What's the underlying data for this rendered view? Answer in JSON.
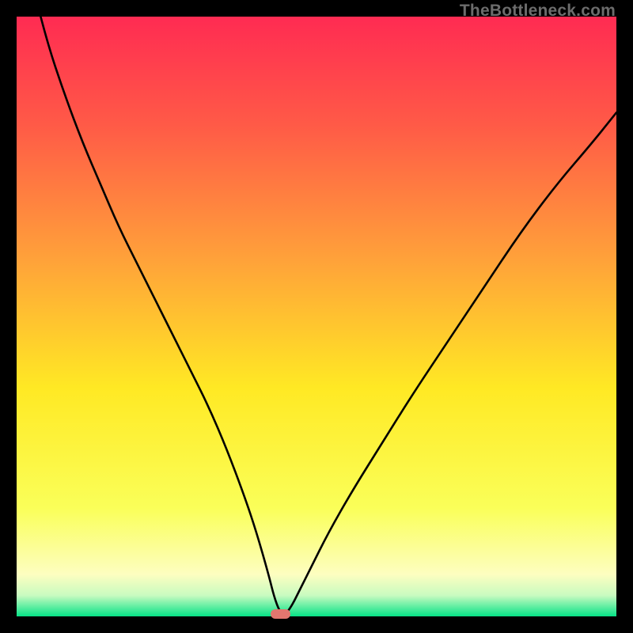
{
  "watermark": "TheBottleneck.com",
  "chart_data": {
    "type": "line",
    "title": "",
    "xlabel": "",
    "ylabel": "",
    "xlim": [
      0,
      100
    ],
    "ylim": [
      0,
      100
    ],
    "grid": false,
    "legend": false,
    "background_gradient": {
      "top": "#ff2b52",
      "mid_top": "#ffa03a",
      "mid": "#ffe924",
      "mid_bottom": "#fdfec0",
      "bottom": "#06e386"
    },
    "curve": {
      "description": "V-shaped bottleneck curve: steep descent from top-left to a near-zero minimum around x≈44, then rising toward top-right",
      "x": [
        0,
        2,
        5,
        8,
        11,
        14,
        17,
        20,
        23,
        26,
        29,
        32,
        35,
        38,
        40,
        42,
        43,
        44,
        45,
        46,
        47,
        49,
        52,
        56,
        61,
        66,
        72,
        78,
        84,
        90,
        96,
        100
      ],
      "y": [
        120,
        108,
        96,
        87,
        79,
        72,
        65,
        59,
        53,
        47,
        41,
        35,
        28,
        20,
        14,
        7,
        3,
        0.5,
        0.5,
        2,
        4,
        8,
        14,
        21,
        29,
        37,
        46,
        55,
        64,
        72,
        79,
        84
      ]
    },
    "marker": {
      "x": 44,
      "y": 0.4,
      "width_pct": 3.2,
      "height_pct": 1.5,
      "color": "#e2766f"
    }
  },
  "layout": {
    "outer": 800,
    "inner": 758,
    "margin": 21
  }
}
